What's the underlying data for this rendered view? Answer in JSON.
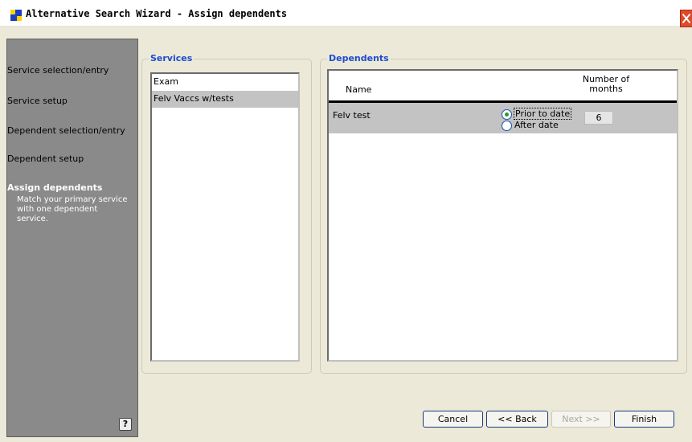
{
  "window": {
    "title": "Alternative Search Wizard - Assign dependents"
  },
  "sidebar": {
    "items": [
      {
        "label": "Service selection/entry"
      },
      {
        "label": "Service setup"
      },
      {
        "label": "Dependent selection/entry"
      },
      {
        "label": "Dependent setup"
      }
    ],
    "active": {
      "title": "Assign dependents",
      "description": "Match your primary service with one dependent service."
    },
    "help_label": "?"
  },
  "services": {
    "title": "Services",
    "items": [
      "Exam",
      "Felv Vaccs w/tests"
    ],
    "selected_index": 1
  },
  "dependents": {
    "title": "Dependents",
    "headers": {
      "name": "Name",
      "months": "Number of months"
    },
    "rows": [
      {
        "name": "Felv test",
        "option_prior": "Prior to date",
        "option_after": "After date",
        "selected_option": "Prior to date",
        "months": "6"
      }
    ]
  },
  "buttons": {
    "cancel": "Cancel",
    "back": "<< Back",
    "next": "Next >>",
    "finish": "Finish"
  },
  "colors": {
    "accent": "#1c4cd0",
    "sidebar_bg": "#8a8a8a",
    "selection_bg": "#c3c3c3",
    "dialog_bg": "#ece9d8"
  }
}
